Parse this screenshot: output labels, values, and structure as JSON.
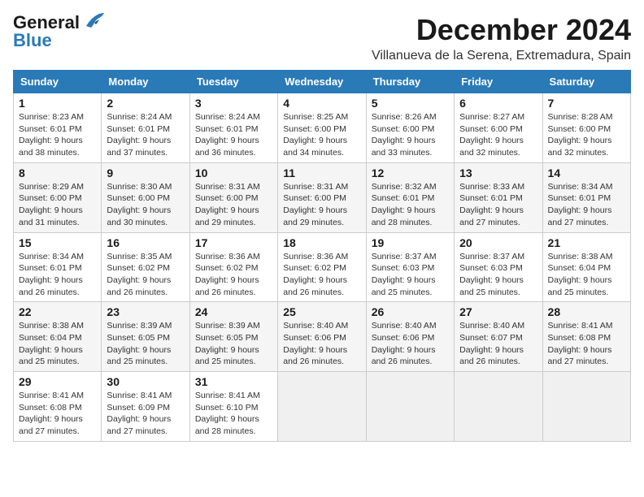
{
  "header": {
    "logo_line1": "General",
    "logo_line2": "Blue",
    "month_title": "December 2024",
    "location": "Villanueva de la Serena, Extremadura, Spain"
  },
  "weekdays": [
    "Sunday",
    "Monday",
    "Tuesday",
    "Wednesday",
    "Thursday",
    "Friday",
    "Saturday"
  ],
  "weeks": [
    [
      {
        "day": "1",
        "sunrise": "8:23 AM",
        "sunset": "6:01 PM",
        "daylight": "9 hours and 38 minutes."
      },
      {
        "day": "2",
        "sunrise": "8:24 AM",
        "sunset": "6:01 PM",
        "daylight": "9 hours and 37 minutes."
      },
      {
        "day": "3",
        "sunrise": "8:24 AM",
        "sunset": "6:01 PM",
        "daylight": "9 hours and 36 minutes."
      },
      {
        "day": "4",
        "sunrise": "8:25 AM",
        "sunset": "6:00 PM",
        "daylight": "9 hours and 34 minutes."
      },
      {
        "day": "5",
        "sunrise": "8:26 AM",
        "sunset": "6:00 PM",
        "daylight": "9 hours and 33 minutes."
      },
      {
        "day": "6",
        "sunrise": "8:27 AM",
        "sunset": "6:00 PM",
        "daylight": "9 hours and 32 minutes."
      },
      {
        "day": "7",
        "sunrise": "8:28 AM",
        "sunset": "6:00 PM",
        "daylight": "9 hours and 32 minutes."
      }
    ],
    [
      {
        "day": "8",
        "sunrise": "8:29 AM",
        "sunset": "6:00 PM",
        "daylight": "9 hours and 31 minutes."
      },
      {
        "day": "9",
        "sunrise": "8:30 AM",
        "sunset": "6:00 PM",
        "daylight": "9 hours and 30 minutes."
      },
      {
        "day": "10",
        "sunrise": "8:31 AM",
        "sunset": "6:00 PM",
        "daylight": "9 hours and 29 minutes."
      },
      {
        "day": "11",
        "sunrise": "8:31 AM",
        "sunset": "6:00 PM",
        "daylight": "9 hours and 29 minutes."
      },
      {
        "day": "12",
        "sunrise": "8:32 AM",
        "sunset": "6:01 PM",
        "daylight": "9 hours and 28 minutes."
      },
      {
        "day": "13",
        "sunrise": "8:33 AM",
        "sunset": "6:01 PM",
        "daylight": "9 hours and 27 minutes."
      },
      {
        "day": "14",
        "sunrise": "8:34 AM",
        "sunset": "6:01 PM",
        "daylight": "9 hours and 27 minutes."
      }
    ],
    [
      {
        "day": "15",
        "sunrise": "8:34 AM",
        "sunset": "6:01 PM",
        "daylight": "9 hours and 26 minutes."
      },
      {
        "day": "16",
        "sunrise": "8:35 AM",
        "sunset": "6:02 PM",
        "daylight": "9 hours and 26 minutes."
      },
      {
        "day": "17",
        "sunrise": "8:36 AM",
        "sunset": "6:02 PM",
        "daylight": "9 hours and 26 minutes."
      },
      {
        "day": "18",
        "sunrise": "8:36 AM",
        "sunset": "6:02 PM",
        "daylight": "9 hours and 26 minutes."
      },
      {
        "day": "19",
        "sunrise": "8:37 AM",
        "sunset": "6:03 PM",
        "daylight": "9 hours and 25 minutes."
      },
      {
        "day": "20",
        "sunrise": "8:37 AM",
        "sunset": "6:03 PM",
        "daylight": "9 hours and 25 minutes."
      },
      {
        "day": "21",
        "sunrise": "8:38 AM",
        "sunset": "6:04 PM",
        "daylight": "9 hours and 25 minutes."
      }
    ],
    [
      {
        "day": "22",
        "sunrise": "8:38 AM",
        "sunset": "6:04 PM",
        "daylight": "9 hours and 25 minutes."
      },
      {
        "day": "23",
        "sunrise": "8:39 AM",
        "sunset": "6:05 PM",
        "daylight": "9 hours and 25 minutes."
      },
      {
        "day": "24",
        "sunrise": "8:39 AM",
        "sunset": "6:05 PM",
        "daylight": "9 hours and 25 minutes."
      },
      {
        "day": "25",
        "sunrise": "8:40 AM",
        "sunset": "6:06 PM",
        "daylight": "9 hours and 26 minutes."
      },
      {
        "day": "26",
        "sunrise": "8:40 AM",
        "sunset": "6:06 PM",
        "daylight": "9 hours and 26 minutes."
      },
      {
        "day": "27",
        "sunrise": "8:40 AM",
        "sunset": "6:07 PM",
        "daylight": "9 hours and 26 minutes."
      },
      {
        "day": "28",
        "sunrise": "8:41 AM",
        "sunset": "6:08 PM",
        "daylight": "9 hours and 27 minutes."
      }
    ],
    [
      {
        "day": "29",
        "sunrise": "8:41 AM",
        "sunset": "6:08 PM",
        "daylight": "9 hours and 27 minutes."
      },
      {
        "day": "30",
        "sunrise": "8:41 AM",
        "sunset": "6:09 PM",
        "daylight": "9 hours and 27 minutes."
      },
      {
        "day": "31",
        "sunrise": "8:41 AM",
        "sunset": "6:10 PM",
        "daylight": "9 hours and 28 minutes."
      },
      null,
      null,
      null,
      null
    ]
  ]
}
